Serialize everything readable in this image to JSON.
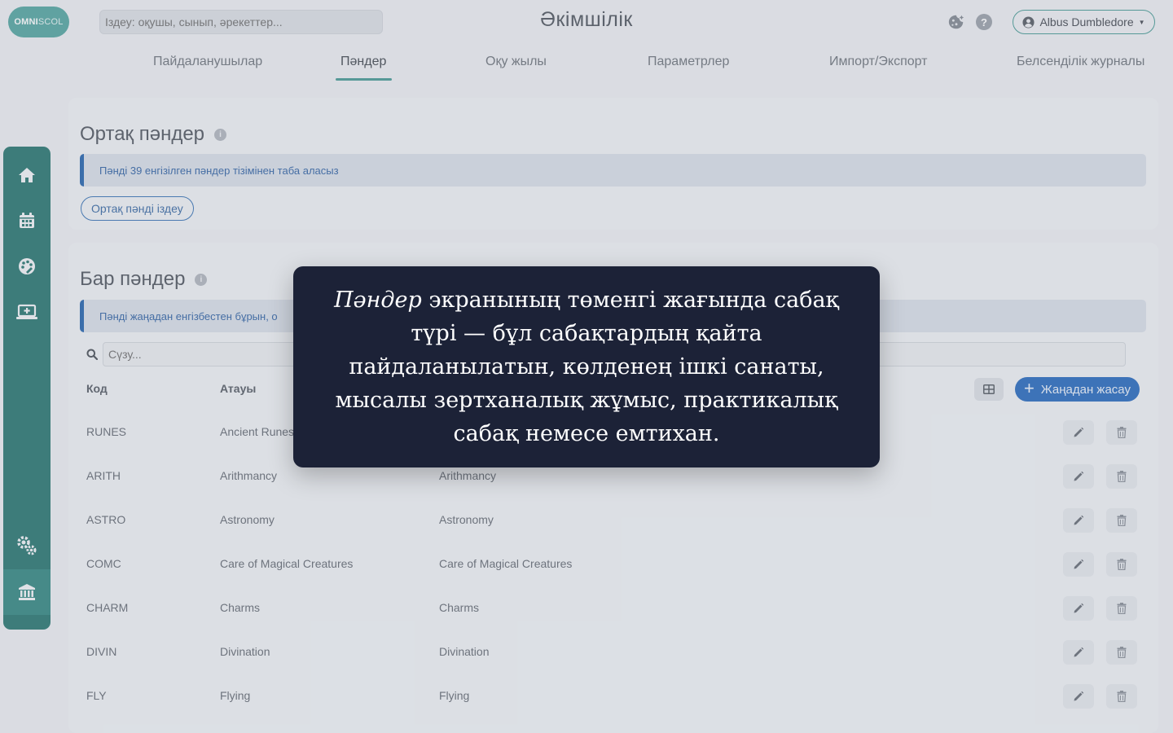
{
  "brand": {
    "logo_part1": "OMNI",
    "logo_part2": "SCOL"
  },
  "header": {
    "search_placeholder": "Іздеу: оқушы, сынып, әрекеттер...",
    "title": "Әкімшілік",
    "user_name": "Albus Dumbledore"
  },
  "tabs": [
    {
      "label": "Пайдаланушылар"
    },
    {
      "label": "Пәндер"
    },
    {
      "label": "Оқу жылы"
    },
    {
      "label": "Параметрлер"
    },
    {
      "label": "Импорт/Экспорт"
    },
    {
      "label": "Белсенділік журналы"
    }
  ],
  "active_tab": "Пәндер",
  "sidebar": {
    "items": [
      "home-icon",
      "calendar-icon",
      "palette-icon",
      "laptop-icon",
      "gears-icon",
      "institution-icon"
    ],
    "active": "institution-icon"
  },
  "shared_subjects": {
    "title": "Ортақ пәндер",
    "alert": "Пәнді 39 енгізілген пәндер тізімінен таба аласыз",
    "search_button": "Ортақ пәнді іздеу"
  },
  "existing_subjects": {
    "title": "Бар пәндер",
    "alert": "Пәнді жаңадан енгізбестен бұрын, о",
    "search_placeholder": "Сүзу...",
    "columns": {
      "code": "Код",
      "name": "Атауы"
    },
    "create_button": "Жаңадан жасау",
    "rows": [
      {
        "code": "RUNES",
        "name": "Ancient Runes",
        "short": ""
      },
      {
        "code": "ARITH",
        "name": "Arithmancy",
        "short": "Arithmancy"
      },
      {
        "code": "ASTRO",
        "name": "Astronomy",
        "short": "Astronomy"
      },
      {
        "code": "COMC",
        "name": "Care of Magical Creatures",
        "short": "Care of Magical Creatures"
      },
      {
        "code": "CHARM",
        "name": "Charms",
        "short": "Charms"
      },
      {
        "code": "DIVIN",
        "name": "Divination",
        "short": "Divination"
      },
      {
        "code": "FLY",
        "name": "Flying",
        "short": "Flying"
      }
    ]
  },
  "tooltip": {
    "emphasis": "Пәндер",
    "text": " экранының төменгі жағында сабақ түрі — бұл сабақтардың қайта пайдаланылатын, көлденең ішкі санаты, мысалы зертханалық жұмыс, практикалық сабақ немесе емтихан."
  },
  "colors": {
    "accent": "#2f7a75",
    "primary": "#2f6fc0",
    "tooltip_bg": "#1c2237"
  }
}
